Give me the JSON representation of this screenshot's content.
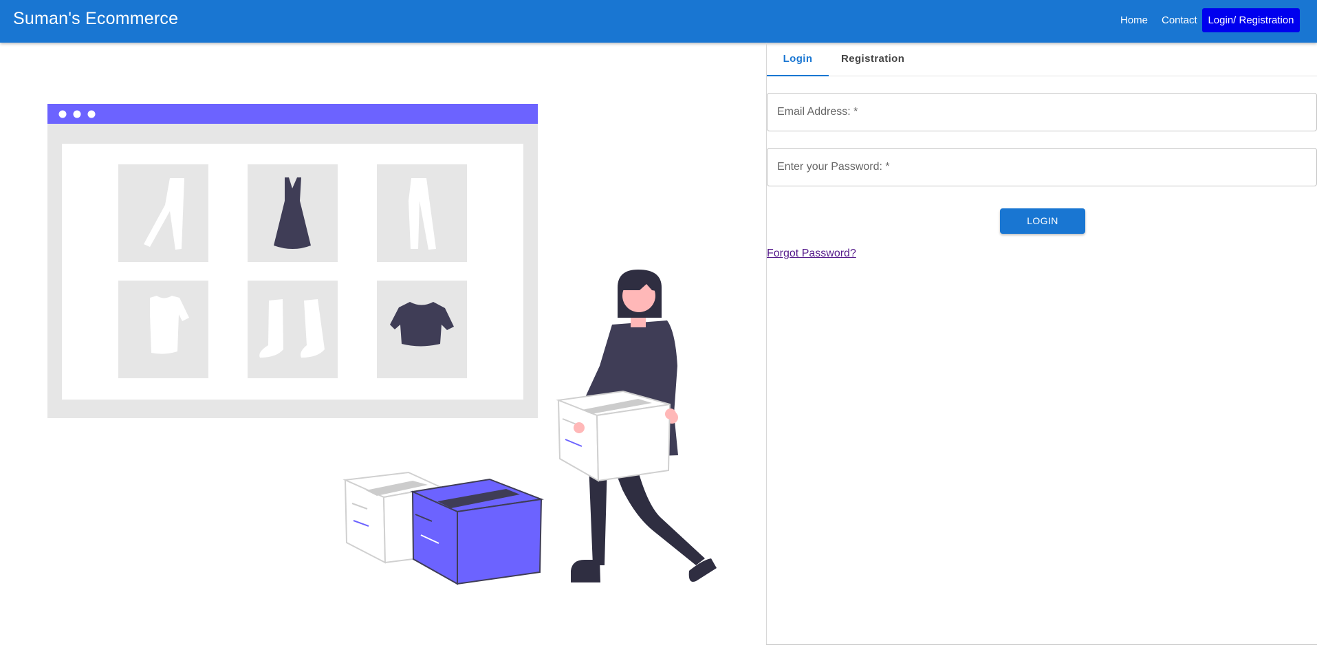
{
  "appbar": {
    "brand": "Suman's Ecommerce",
    "nav": {
      "home": "Home",
      "contact": "Contact",
      "login_registration": "Login/ Registration"
    }
  },
  "tabs": {
    "login": "Login",
    "registration": "Registration",
    "active": "Login"
  },
  "form": {
    "email_placeholder": "Email Address: *",
    "email_value": "",
    "password_placeholder": "Enter your Password: *",
    "password_value": "",
    "login_button": "LOGIN",
    "forgot_link": "Forgot Password?"
  },
  "colors": {
    "primary": "#1976d2",
    "nav_highlight": "#0000ee",
    "illustration_accent": "#6c63ff",
    "illustration_dark": "#3f3d56"
  },
  "illustration": {
    "subject": "online-shopping-illustration",
    "icons": [
      "pants-icon",
      "dress-icon",
      "pants-icon",
      "tshirt-icon",
      "boots-icon",
      "crop-top-icon",
      "box-icon",
      "person-icon"
    ]
  }
}
